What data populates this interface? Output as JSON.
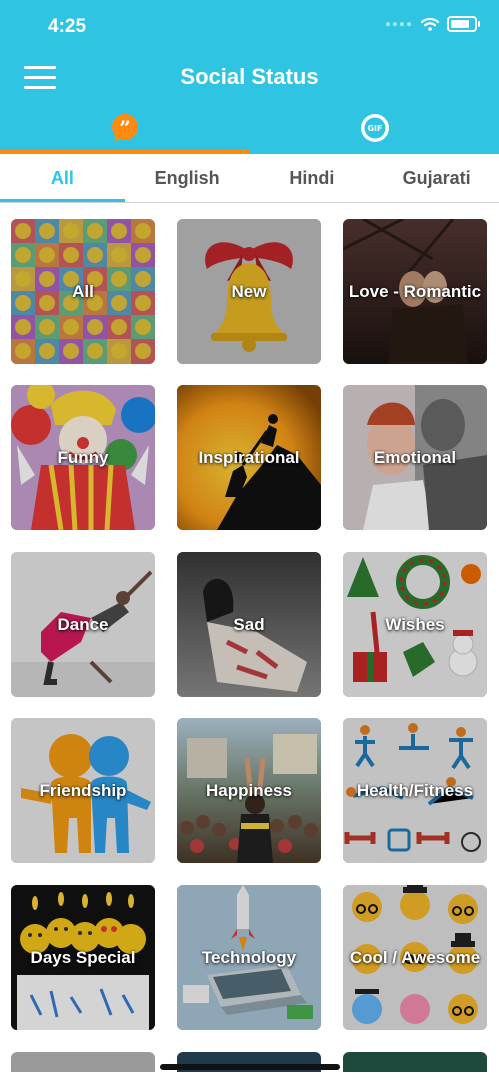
{
  "status_bar": {
    "time": "4:25",
    "battery_level": 0.85
  },
  "header": {
    "title": "Social Status",
    "menu_icon": "hamburger-menu-icon"
  },
  "top_tabs": [
    {
      "icon": "quote-bubble-icon",
      "active": true
    },
    {
      "icon": "gif-icon",
      "active": false,
      "icon_text": "GIF"
    }
  ],
  "language_tabs": [
    {
      "label": "All",
      "active": true
    },
    {
      "label": "English",
      "active": false
    },
    {
      "label": "Hindi",
      "active": false
    },
    {
      "label": "Gujarati",
      "active": false
    }
  ],
  "categories": [
    {
      "label": "All"
    },
    {
      "label": "New"
    },
    {
      "label": "Love - Romantic"
    },
    {
      "label": "Funny"
    },
    {
      "label": "Inspirational"
    },
    {
      "label": "Emotional"
    },
    {
      "label": "Dance"
    },
    {
      "label": "Sad"
    },
    {
      "label": "Wishes"
    },
    {
      "label": "Friendship"
    },
    {
      "label": "Happiness"
    },
    {
      "label": "Health/Fitness"
    },
    {
      "label": "Days Special"
    },
    {
      "label": "Technology"
    },
    {
      "label": "Cool / Awesome"
    }
  ],
  "colors": {
    "header": "#2fc4e2",
    "accent": "#ff8a10",
    "active_tab": "#2fc4e2"
  }
}
